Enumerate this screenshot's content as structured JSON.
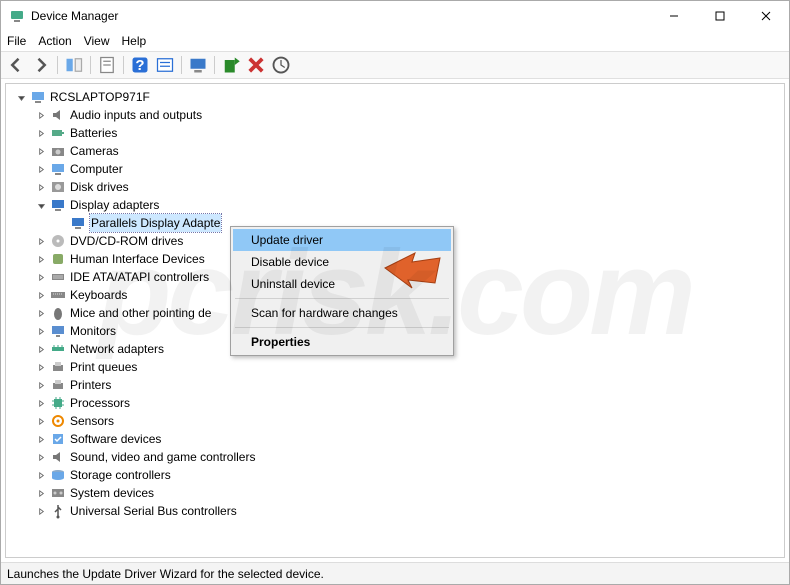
{
  "title": "Device Manager",
  "menubar": {
    "file": "File",
    "action": "Action",
    "view": "View",
    "help": "Help"
  },
  "toolbar_icons": {
    "back": "back-icon",
    "forward": "forward-icon",
    "show_hide": "show-hide-icon",
    "props_sheet": "properties-icon",
    "help": "help-icon",
    "query": "query-icon",
    "monitor": "monitor-icon",
    "update": "update-icon",
    "remove": "remove-icon",
    "scan": "scan-icon"
  },
  "tree": {
    "root": {
      "label": "RCSLAPTOP971F",
      "icon": "computer-icon",
      "expanded": true
    },
    "items": [
      {
        "label": "Audio inputs and outputs",
        "icon": "speaker-icon",
        "expanded": false
      },
      {
        "label": "Batteries",
        "icon": "battery-icon",
        "expanded": false
      },
      {
        "label": "Cameras",
        "icon": "camera-icon",
        "expanded": false
      },
      {
        "label": "Computer",
        "icon": "computer-icon",
        "expanded": false
      },
      {
        "label": "Disk drives",
        "icon": "disk-icon",
        "expanded": false
      },
      {
        "label": "Display adapters",
        "icon": "display-icon",
        "expanded": true,
        "children": [
          {
            "label": "Parallels Display Adapte",
            "icon": "display-icon",
            "selected": true
          }
        ]
      },
      {
        "label": "DVD/CD-ROM drives",
        "icon": "optical-icon",
        "expanded": false
      },
      {
        "label": "Human Interface Devices",
        "icon": "hid-icon",
        "expanded": false
      },
      {
        "label": "IDE ATA/ATAPI controllers",
        "icon": "ide-icon",
        "expanded": false
      },
      {
        "label": "Keyboards",
        "icon": "keyboard-icon",
        "expanded": false
      },
      {
        "label": "Mice and other pointing de",
        "icon": "mouse-icon",
        "expanded": false
      },
      {
        "label": "Monitors",
        "icon": "monitor-icon",
        "expanded": false
      },
      {
        "label": "Network adapters",
        "icon": "network-icon",
        "expanded": false
      },
      {
        "label": "Print queues",
        "icon": "printer-icon",
        "expanded": false
      },
      {
        "label": "Printers",
        "icon": "printer-icon",
        "expanded": false
      },
      {
        "label": "Processors",
        "icon": "cpu-icon",
        "expanded": false
      },
      {
        "label": "Sensors",
        "icon": "sensor-icon",
        "expanded": false
      },
      {
        "label": "Software devices",
        "icon": "software-icon",
        "expanded": false
      },
      {
        "label": "Sound, video and game controllers",
        "icon": "speaker-icon",
        "expanded": false
      },
      {
        "label": "Storage controllers",
        "icon": "storage-icon",
        "expanded": false
      },
      {
        "label": "System devices",
        "icon": "system-icon",
        "expanded": false
      },
      {
        "label": "Universal Serial Bus controllers",
        "icon": "usb-icon",
        "expanded": false
      }
    ]
  },
  "context_menu": {
    "update": "Update driver",
    "disable": "Disable device",
    "uninstall": "Uninstall device",
    "scan": "Scan for hardware changes",
    "properties": "Properties"
  },
  "statusbar": "Launches the Update Driver Wizard for the selected device.",
  "watermark": "pcrisk.com"
}
